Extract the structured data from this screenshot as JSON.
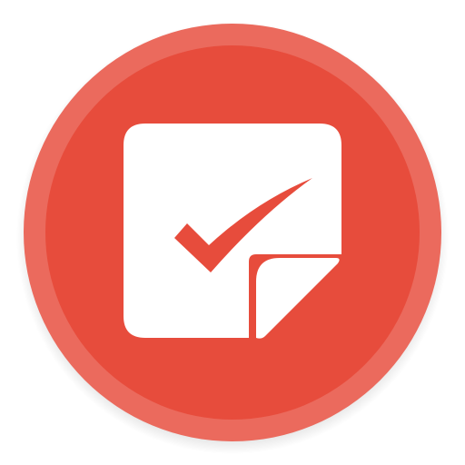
{
  "icon": {
    "name": "task-checklist-app-icon",
    "glyph": "check-note-icon",
    "colors": {
      "outer_ring": "#EB6A5D",
      "inner_disc": "#E74C3C",
      "note": "#FFFFFF",
      "checkmark": "#E74C3C",
      "page_curl": "#FFFFFF",
      "shadow": "#D9D9D9"
    }
  }
}
